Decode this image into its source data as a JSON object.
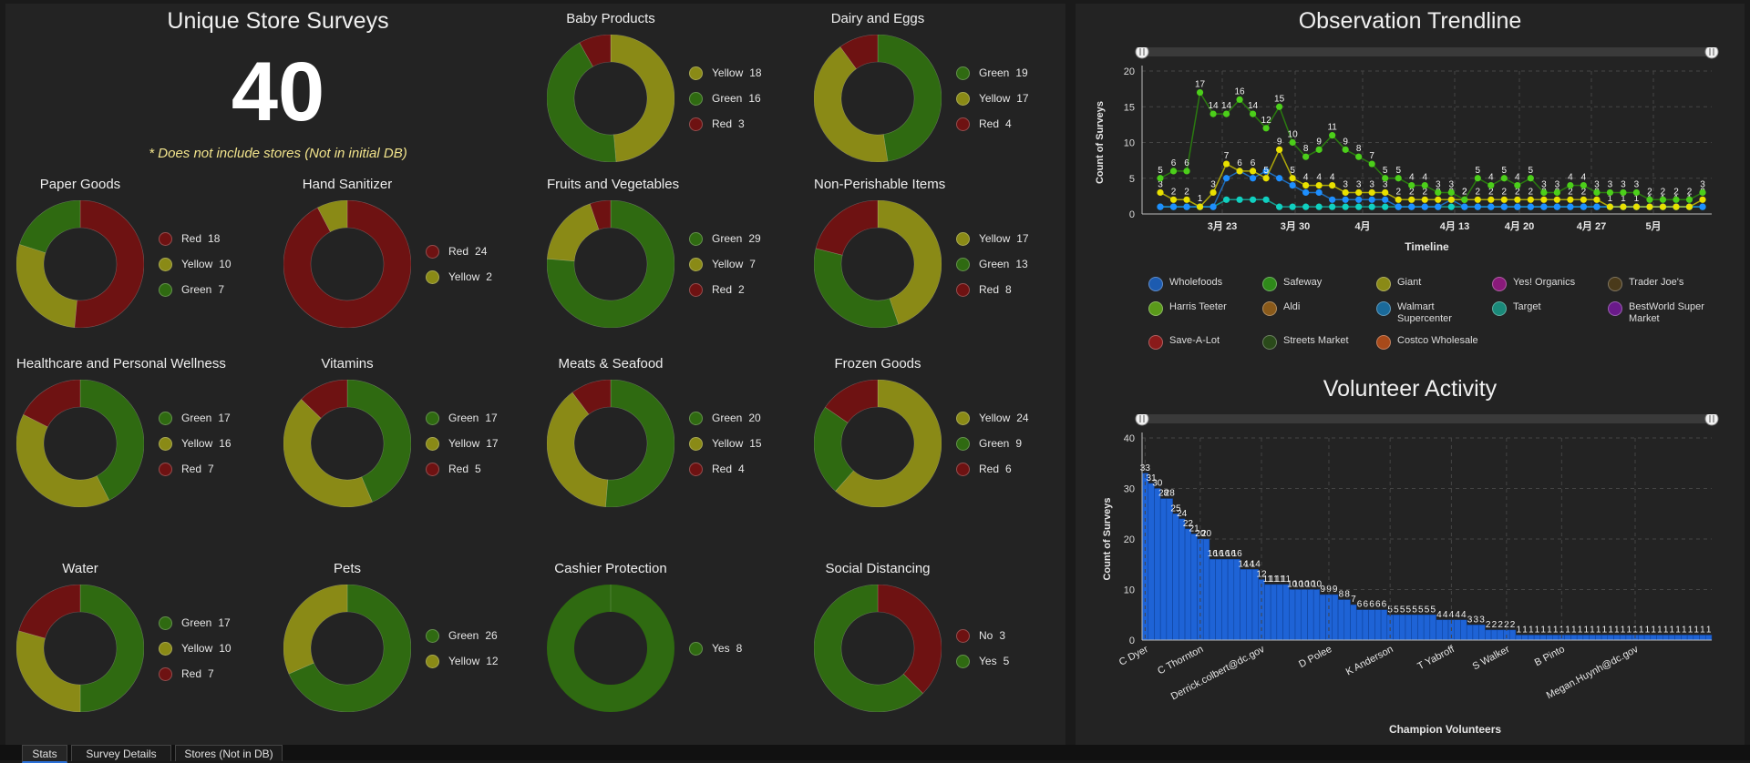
{
  "kpi": {
    "title": "Unique Store Surveys",
    "value": "40",
    "note": "* Does not include stores (Not in initial DB)"
  },
  "colors": {
    "Green": "#2f6a11",
    "Yellow": "#8a8a16",
    "Red": "#6e1212",
    "No": "#6e1212",
    "Yes": "#2f6a11"
  },
  "donuts": [
    {
      "id": "baby-products",
      "title": "Baby Products",
      "slices": [
        {
          "label": "Yellow",
          "value": 18
        },
        {
          "label": "Green",
          "value": 16
        },
        {
          "label": "Red",
          "value": 3
        }
      ]
    },
    {
      "id": "dairy-and-eggs",
      "title": "Dairy and Eggs",
      "slices": [
        {
          "label": "Green",
          "value": 19
        },
        {
          "label": "Yellow",
          "value": 17
        },
        {
          "label": "Red",
          "value": 4
        }
      ]
    },
    {
      "id": "paper-goods",
      "title": "Paper Goods",
      "slices": [
        {
          "label": "Red",
          "value": 18
        },
        {
          "label": "Yellow",
          "value": 10
        },
        {
          "label": "Green",
          "value": 7
        }
      ]
    },
    {
      "id": "hand-sanitizer",
      "title": "Hand Sanitizer",
      "slices": [
        {
          "label": "Red",
          "value": 24
        },
        {
          "label": "Yellow",
          "value": 2
        }
      ]
    },
    {
      "id": "fruits-and-vegetables",
      "title": "Fruits and Vegetables",
      "slices": [
        {
          "label": "Green",
          "value": 29
        },
        {
          "label": "Yellow",
          "value": 7
        },
        {
          "label": "Red",
          "value": 2
        }
      ]
    },
    {
      "id": "non-perishable-items",
      "title": "Non-Perishable Items",
      "slices": [
        {
          "label": "Yellow",
          "value": 17
        },
        {
          "label": "Green",
          "value": 13
        },
        {
          "label": "Red",
          "value": 8
        }
      ]
    },
    {
      "id": "healthcare",
      "title": "Healthcare and Personal Wellness",
      "slices": [
        {
          "label": "Green",
          "value": 17
        },
        {
          "label": "Yellow",
          "value": 16
        },
        {
          "label": "Red",
          "value": 7
        }
      ]
    },
    {
      "id": "vitamins",
      "title": "Vitamins",
      "slices": [
        {
          "label": "Green",
          "value": 17
        },
        {
          "label": "Yellow",
          "value": 17
        },
        {
          "label": "Red",
          "value": 5
        }
      ]
    },
    {
      "id": "meats-seafood",
      "title": "Meats & Seafood",
      "slices": [
        {
          "label": "Green",
          "value": 20
        },
        {
          "label": "Yellow",
          "value": 15
        },
        {
          "label": "Red",
          "value": 4
        }
      ]
    },
    {
      "id": "frozen-goods",
      "title": "Frozen Goods",
      "slices": [
        {
          "label": "Yellow",
          "value": 24
        },
        {
          "label": "Green",
          "value": 9
        },
        {
          "label": "Red",
          "value": 6
        }
      ]
    },
    {
      "id": "water",
      "title": "Water",
      "slices": [
        {
          "label": "Green",
          "value": 17
        },
        {
          "label": "Yellow",
          "value": 10
        },
        {
          "label": "Red",
          "value": 7
        }
      ]
    },
    {
      "id": "pets",
      "title": "Pets",
      "slices": [
        {
          "label": "Green",
          "value": 26
        },
        {
          "label": "Yellow",
          "value": 12
        }
      ]
    },
    {
      "id": "cashier-protection",
      "title": "Cashier Protection",
      "slices": [
        {
          "label": "Yes",
          "value": 8
        }
      ]
    },
    {
      "id": "social-distancing",
      "title": "Social Distancing",
      "slices": [
        {
          "label": "No",
          "value": 3
        },
        {
          "label": "Yes",
          "value": 5
        }
      ]
    }
  ],
  "chart_data": [
    {
      "type": "line",
      "title": "Observation Trendline",
      "xlabel": "Timeline",
      "ylabel": "Count of Surveys",
      "ylim": [
        0,
        20
      ],
      "yticks": [
        0,
        5,
        10,
        15,
        20
      ],
      "xticks": [
        "3月 23",
        "3月 30",
        "4月",
        "4月 13",
        "4月 20",
        "4月 27",
        "5月"
      ],
      "grid": true,
      "legend_position": "bottom",
      "legend": [
        {
          "name": "Wholefoods",
          "color": "#1c5bb0"
        },
        {
          "name": "Safeway",
          "color": "#2f8a1a"
        },
        {
          "name": "Giant",
          "color": "#8a8a16"
        },
        {
          "name": "Yes! Organics",
          "color": "#8a1a7a"
        },
        {
          "name": "Trader Joe's",
          "color": "#4a3a1a"
        },
        {
          "name": "Harris Teeter",
          "color": "#5a9a1a"
        },
        {
          "name": "Aldi",
          "color": "#8a5a1a"
        },
        {
          "name": "Walmart Supercenter",
          "color": "#1a6a9a"
        },
        {
          "name": "Target",
          "color": "#1a8a7a"
        },
        {
          "name": "BestWorld Super Market",
          "color": "#6a1a8a"
        },
        {
          "name": "Save-A-Lot",
          "color": "#8a1a1a"
        },
        {
          "name": "Streets Market",
          "color": "#2a4a1a"
        },
        {
          "name": "Costco Wholesale",
          "color": "#a84a1a"
        }
      ],
      "series": [
        {
          "name": "Safeway",
          "color": "#4ccf1a",
          "values": [
            5,
            6,
            6,
            17,
            14,
            14,
            16,
            14,
            12,
            15,
            10,
            8,
            9,
            11,
            9,
            8,
            7,
            5,
            5,
            4,
            4,
            3,
            3,
            2,
            5,
            4,
            5,
            4,
            5,
            3,
            3,
            4,
            4,
            3,
            3,
            3,
            3,
            2,
            2,
            2,
            2,
            3
          ]
        },
        {
          "name": "Giant",
          "color": "#e8e000",
          "values": [
            3,
            2,
            2,
            1,
            3,
            7,
            6,
            6,
            5,
            9,
            5,
            4,
            4,
            4,
            3,
            3,
            3,
            3,
            2,
            2,
            2,
            2,
            2,
            2,
            2,
            2,
            2,
            2,
            2,
            2,
            2,
            2,
            2,
            2,
            1,
            1,
            1,
            1,
            1,
            1,
            1,
            2
          ]
        },
        {
          "name": "Wholefoods",
          "color": "#1e8fff",
          "values": [
            1,
            1,
            1,
            1,
            1,
            5,
            6,
            5,
            6,
            5,
            4,
            3,
            3,
            2,
            2,
            2,
            2,
            2,
            1,
            1,
            1,
            1,
            2,
            1,
            1,
            1,
            1,
            1,
            1,
            1,
            1,
            1,
            1,
            1,
            1,
            1,
            1,
            1,
            1,
            1,
            1,
            1
          ]
        },
        {
          "name": "Target",
          "color": "#10d0c0",
          "values": [
            1,
            1,
            1,
            1,
            1,
            2,
            2,
            2,
            2,
            1,
            1,
            1,
            1,
            1,
            1,
            1,
            1,
            1,
            1,
            1,
            1,
            1,
            1,
            1,
            1,
            1,
            1,
            1,
            1,
            1,
            1,
            1,
            1,
            1,
            1,
            1,
            1,
            1,
            1,
            1,
            1,
            1
          ]
        }
      ]
    },
    {
      "type": "bar",
      "title": "Volunteer Activity",
      "xlabel": "Champion Volunteers",
      "ylabel": "Count of Surveys",
      "ylim": [
        0,
        40
      ],
      "yticks": [
        0,
        10,
        20,
        30,
        40
      ],
      "tick_labels": [
        "C Dyer",
        "C Thornton",
        "Derrick.colbert@dc.gov",
        "D Polee",
        "K Anderson",
        "T Yabroff",
        "S Walker",
        "B Pinto",
        "Megan.Huynh@dc.gov"
      ],
      "values": [
        33,
        31,
        30,
        28,
        28,
        25,
        24,
        22,
        21,
        20,
        20,
        16,
        16,
        16,
        16,
        16,
        14,
        14,
        14,
        12,
        11,
        11,
        11,
        11,
        10,
        10,
        10,
        10,
        10,
        9,
        9,
        9,
        8,
        8,
        7,
        6,
        6,
        6,
        6,
        6,
        5,
        5,
        5,
        5,
        5,
        5,
        5,
        5,
        4,
        4,
        4,
        4,
        4,
        3,
        3,
        3,
        2,
        2,
        2,
        2,
        2,
        1,
        1,
        1,
        1,
        1,
        1,
        1,
        1,
        1,
        1,
        1,
        1,
        1,
        1,
        1,
        1,
        1,
        1,
        1,
        1,
        1,
        1,
        1,
        1,
        1,
        1,
        1,
        1,
        1,
        1,
        1,
        1
      ],
      "color": "#1e63d6"
    }
  ],
  "tabs": [
    "Stats",
    "Survey Details",
    "Stores (Not in DB)"
  ]
}
